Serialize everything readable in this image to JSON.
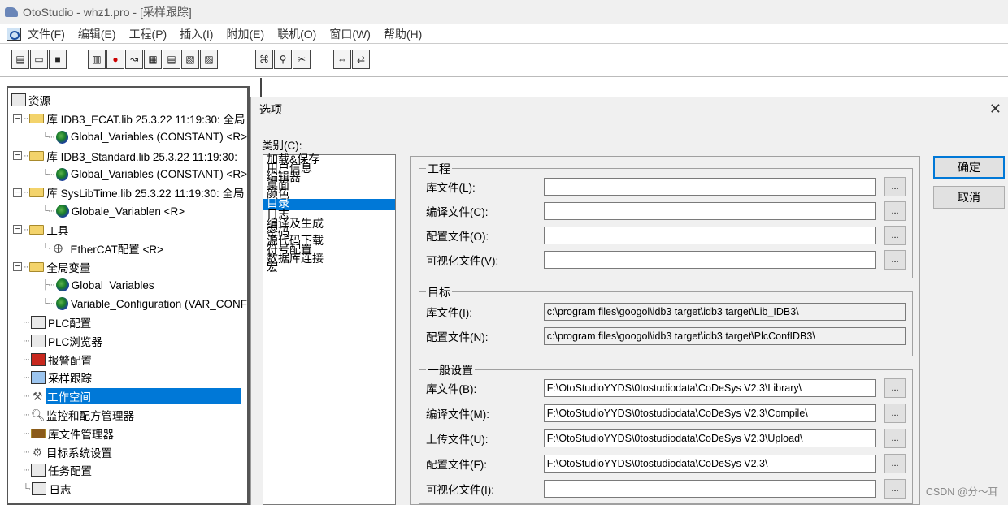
{
  "window": {
    "title": "OtoStudio - whz1.pro - [采样跟踪]"
  },
  "menu": [
    "文件(F)",
    "编辑(E)",
    "工程(P)",
    "插入(I)",
    "附加(E)",
    "联机(O)",
    "窗口(W)",
    "帮助(H)"
  ],
  "tree": {
    "root": "资源",
    "items": [
      {
        "label": "库 IDB3_ECAT.lib 25.3.22 11:19:30: 全局"
      },
      {
        "label": "Global_Variables (CONSTANT) <R>"
      },
      {
        "label": "库 IDB3_Standard.lib 25.3.22 11:19:30:"
      },
      {
        "label": "Global_Variables (CONSTANT) <R>"
      },
      {
        "label": "库 SysLibTime.lib 25.3.22 11:19:30: 全局"
      },
      {
        "label": "Globale_Variablen <R>"
      },
      {
        "label": "工具"
      },
      {
        "label": "EtherCAT配置  <R>"
      },
      {
        "label": "全局变量"
      },
      {
        "label": "Global_Variables"
      },
      {
        "label": "Variable_Configuration (VAR_CONF"
      },
      {
        "label": "PLC配置"
      },
      {
        "label": "PLC浏览器"
      },
      {
        "label": "报警配置"
      },
      {
        "label": "采样跟踪"
      },
      {
        "label": "工作空间"
      },
      {
        "label": "监控和配方管理器"
      },
      {
        "label": "库文件管理器"
      },
      {
        "label": "目标系统设置"
      },
      {
        "label": "任务配置"
      },
      {
        "label": "日志"
      }
    ]
  },
  "dialog": {
    "title": "选项",
    "close": "✕",
    "category_label": "类别(C):",
    "categories": [
      "加载&保存",
      "用户信息",
      "编辑器",
      "桌面",
      "颜色",
      "目录",
      "日志",
      "编译及生成",
      "密码",
      "源代码下载",
      "符号配置",
      "数据库连接",
      "宏"
    ],
    "selected_category": "目录",
    "ok": "确定",
    "cancel": "取消",
    "browse": "...",
    "project": {
      "legend": "工程",
      "rows": [
        {
          "label": "库文件(L):",
          "value": ""
        },
        {
          "label": "编译文件(C):",
          "value": ""
        },
        {
          "label": "配置文件(O):",
          "value": ""
        },
        {
          "label": "可视化文件(V):",
          "value": ""
        }
      ]
    },
    "target": {
      "legend": "目标",
      "rows": [
        {
          "label": "库文件(I):",
          "value": "c:\\program files\\googol\\idb3 target\\idb3 target\\Lib_IDB3\\"
        },
        {
          "label": "配置文件(N):",
          "value": "c:\\program files\\googol\\idb3 target\\idb3 target\\PlcConfIDB3\\"
        }
      ]
    },
    "general": {
      "legend": "一般设置",
      "rows": [
        {
          "label": "库文件(B):",
          "value": "F:\\OtoStudioYYDS\\0tostudiodata\\CoDeSys V2.3\\Library\\"
        },
        {
          "label": "编译文件(M):",
          "value": "F:\\OtoStudioYYDS\\0tostudiodata\\CoDeSys V2.3\\Compile\\"
        },
        {
          "label": "上传文件(U):",
          "value": "F:\\OtoStudioYYDS\\0tostudiodata\\CoDeSys V2.3\\Upload\\"
        },
        {
          "label": "配置文件(F):",
          "value": "F:\\OtoStudioYYDS\\0tostudiodata\\CoDeSys V2.3\\"
        },
        {
          "label": "可视化文件(I):",
          "value": ""
        }
      ]
    }
  },
  "watermark": "CSDN @分～耳"
}
